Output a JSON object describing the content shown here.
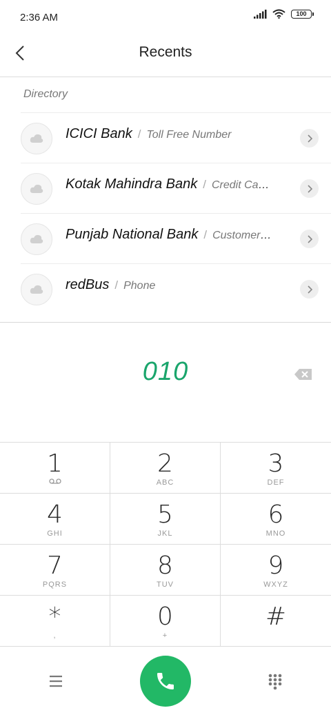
{
  "status_bar": {
    "time": "2:36 AM",
    "battery": "100"
  },
  "header": {
    "title": "Recents"
  },
  "section": {
    "label": "Directory"
  },
  "directory": [
    {
      "name": "ICICI Bank",
      "sub": "Toll Free Number"
    },
    {
      "name": "Kotak Mahindra Bank",
      "sub": "Credit Card/..."
    },
    {
      "name": "Punjab National Bank",
      "sub": "Customer C..."
    },
    {
      "name": "redBus",
      "sub": "Phone"
    }
  ],
  "dial": {
    "number": "010"
  },
  "keypad": [
    [
      {
        "digit": "1",
        "letters": ""
      },
      {
        "digit": "2",
        "letters": "ABC"
      },
      {
        "digit": "3",
        "letters": "DEF"
      }
    ],
    [
      {
        "digit": "4",
        "letters": "GHI"
      },
      {
        "digit": "5",
        "letters": "JKL"
      },
      {
        "digit": "6",
        "letters": "MNO"
      }
    ],
    [
      {
        "digit": "7",
        "letters": "PQRS"
      },
      {
        "digit": "8",
        "letters": "TUV"
      },
      {
        "digit": "9",
        "letters": "WXYZ"
      }
    ],
    [
      {
        "digit": "*",
        "letters": ","
      },
      {
        "digit": "0",
        "letters": "+"
      },
      {
        "digit": "#",
        "letters": ""
      }
    ]
  ],
  "colors": {
    "accent": "#1aa56c",
    "call_button": "#22b866"
  }
}
